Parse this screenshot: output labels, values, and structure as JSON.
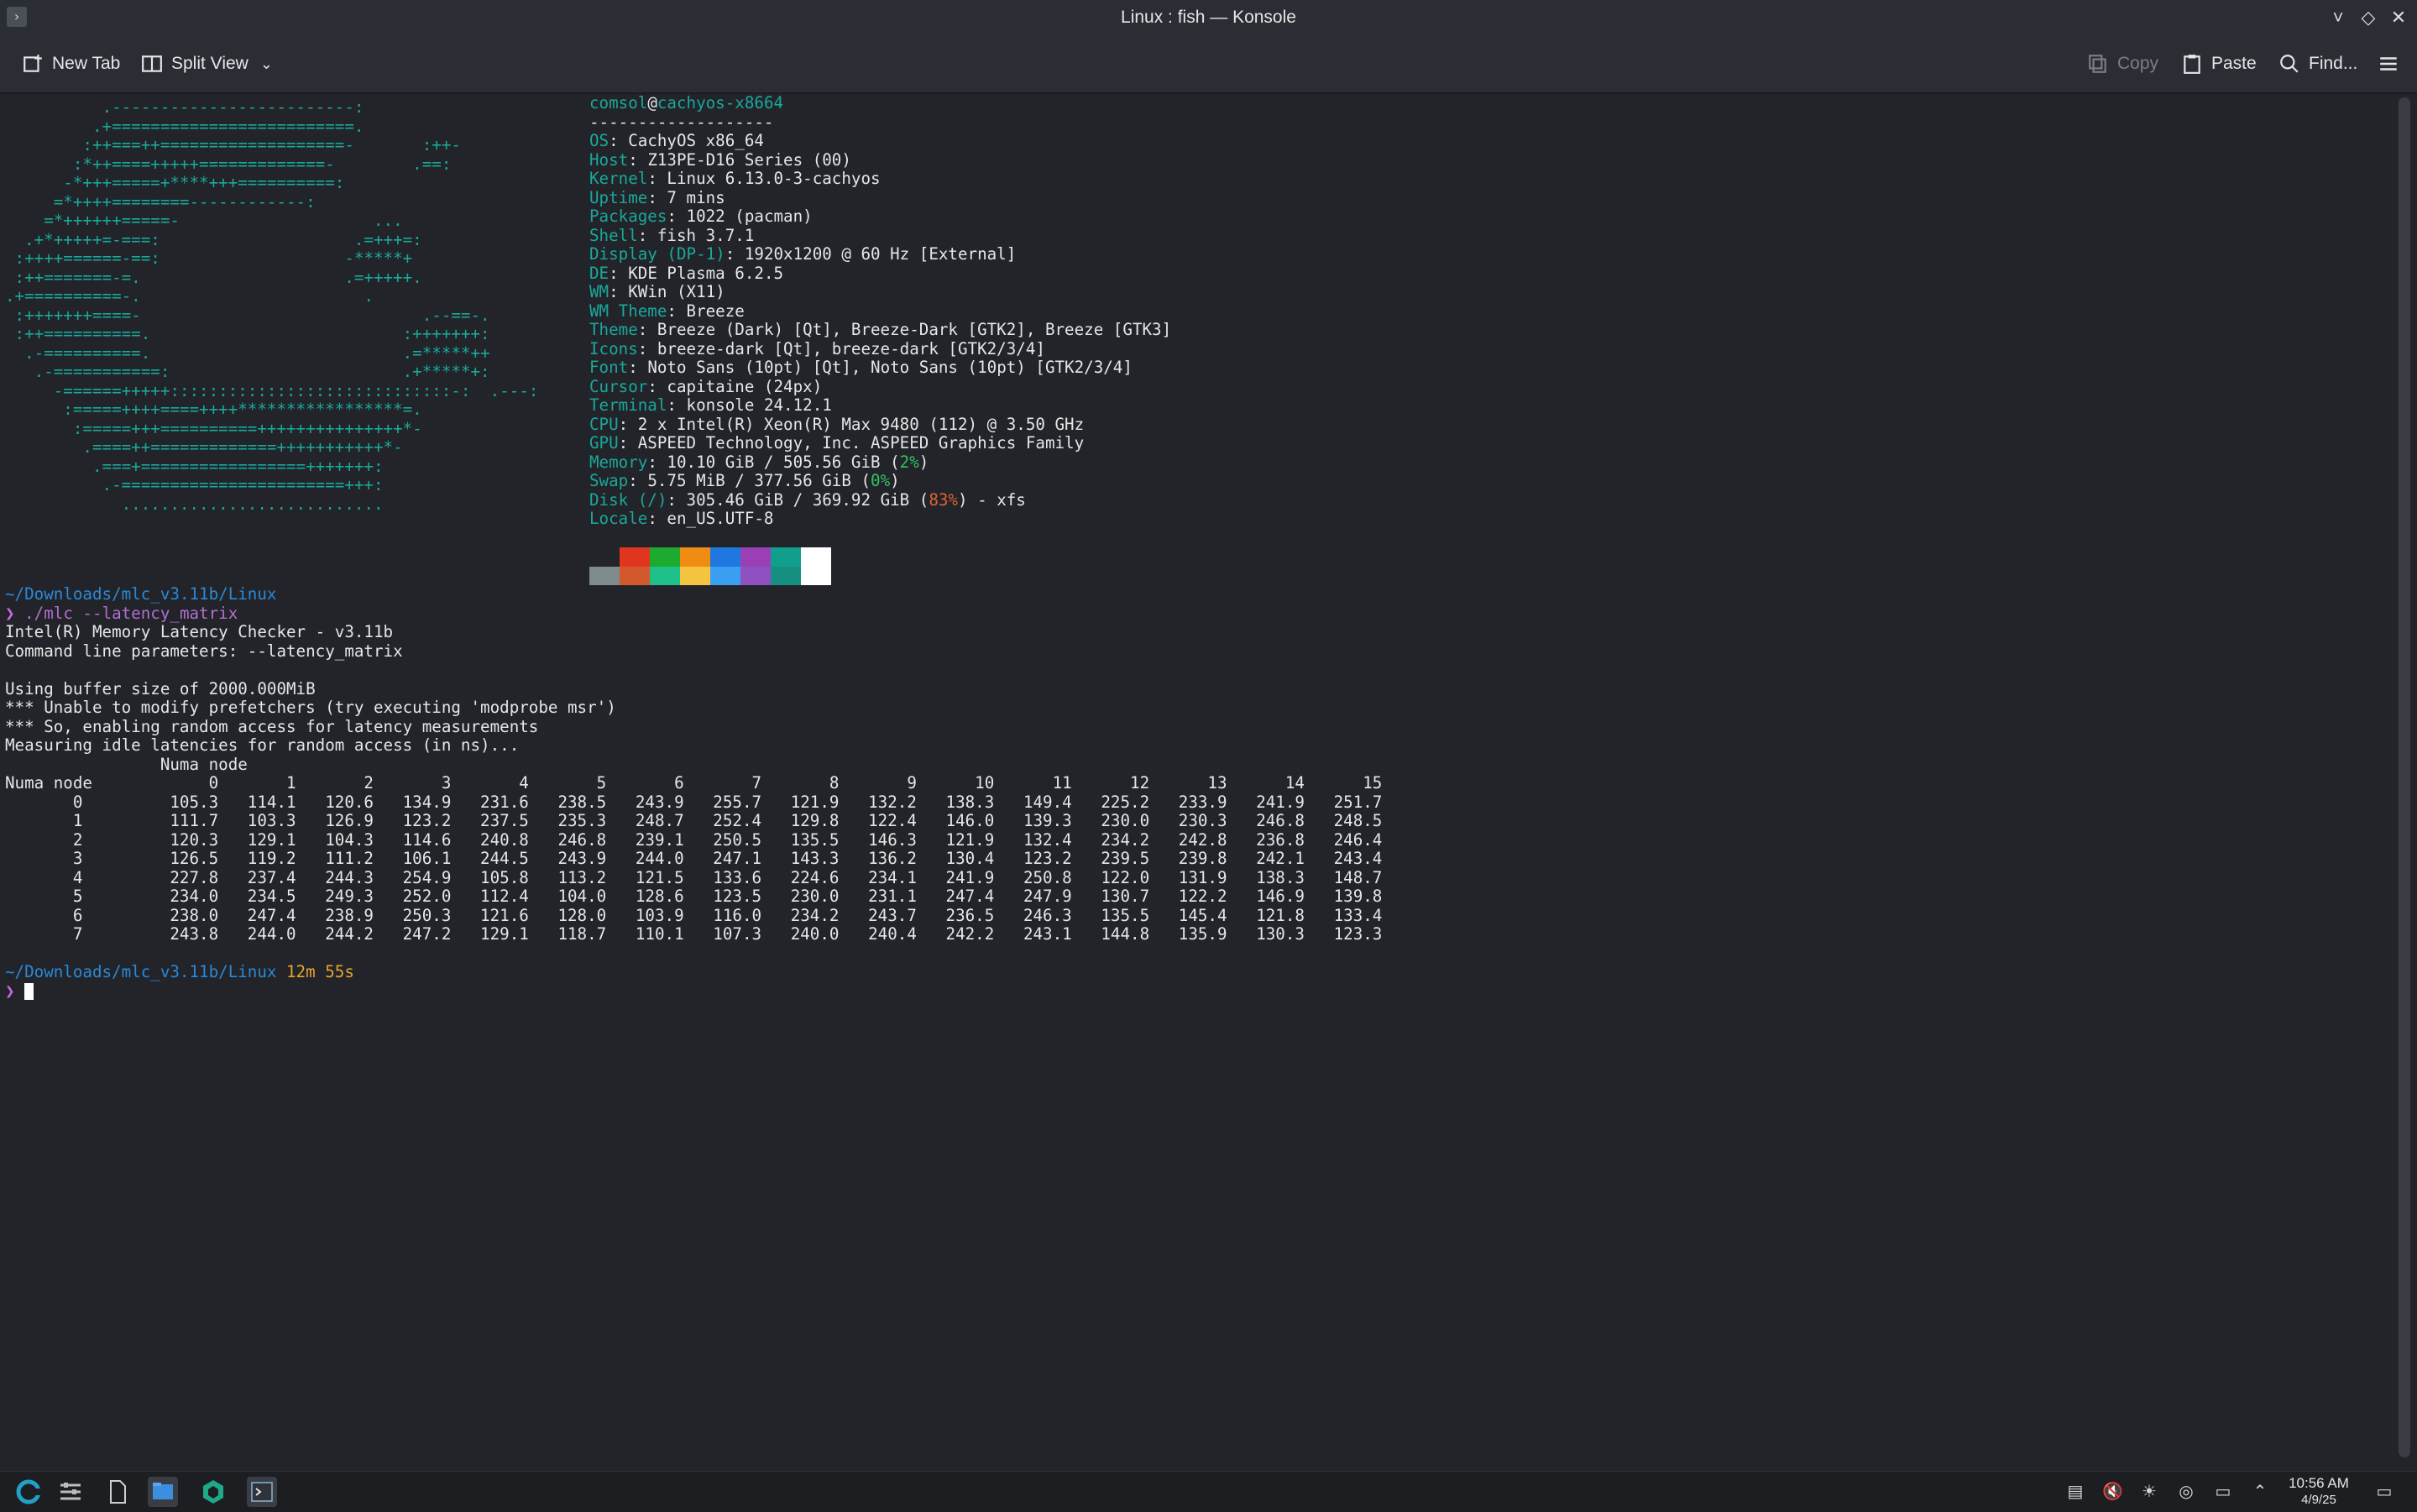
{
  "window": {
    "title": "Linux : fish — Konsole",
    "controls": [
      "˅",
      "◇",
      "✕"
    ]
  },
  "toolbar": {
    "new_tab": "New Tab",
    "split_view": "Split View",
    "copy": "Copy",
    "paste": "Paste",
    "find": "Find..."
  },
  "ascii_art": [
    "          .-------------------------:",
    "         .+=========================.",
    "        :++===++===================-       :++-",
    "       :*++====+++++=============-        .==:",
    "      -*+++=====+****+++==========:",
    "     =*++++========------------:",
    "    =*++++++=====-                    ...",
    "  .+*+++++=-===:                    .=+++=:",
    " :++++======-==:                   -*****+",
    " :++=======-=.                     .=+++++.",
    ".+==========-.                       .",
    " :+++++++====-                             .--==-.",
    " :++==========.                          :+++++++:",
    "  .-==========.                          .=*****++",
    "   .-===========:                        .+*****+:",
    "     -======+++++:::::::::::::::::::::::::::::-:  .---:",
    "      :=====++++====++++*****************=.",
    "       :=====+++==========+++++++++++++++*-",
    "        .====++=============+++++++++++*-",
    "         .===+=================+++++++:",
    "          .-=======================+++:",
    "            ..........................."
  ],
  "sysinfo": {
    "user": "comsol",
    "at": "@",
    "host": "cachyos-x8664",
    "separator": "-------------------",
    "rows": [
      {
        "key": "OS",
        "value": ": CachyOS x86_64"
      },
      {
        "key": "Host",
        "value": ": Z13PE-D16 Series (00)"
      },
      {
        "key": "Kernel",
        "value": ": Linux 6.13.0-3-cachyos"
      },
      {
        "key": "Uptime",
        "value": ": 7 mins"
      },
      {
        "key": "Packages",
        "value": ": 1022 (pacman)"
      },
      {
        "key": "Shell",
        "value": ": fish 3.7.1"
      },
      {
        "key": "Display (DP-1)",
        "value": ": 1920x1200 @ 60 Hz [External]"
      },
      {
        "key": "DE",
        "value": ": KDE Plasma 6.2.5"
      },
      {
        "key": "WM",
        "value": ": KWin (X11)"
      },
      {
        "key": "WM Theme",
        "value": ": Breeze"
      },
      {
        "key": "Theme",
        "value": ": Breeze (Dark) [Qt], Breeze-Dark [GTK2], Breeze [GTK3]"
      },
      {
        "key": "Icons",
        "value": ": breeze-dark [Qt], breeze-dark [GTK2/3/4]"
      },
      {
        "key": "Font",
        "value": ": Noto Sans (10pt) [Qt], Noto Sans (10pt) [GTK2/3/4]"
      },
      {
        "key": "Cursor",
        "value": ": capitaine (24px)"
      },
      {
        "key": "Terminal",
        "value": ": konsole 24.12.1"
      },
      {
        "key": "CPU",
        "value": ": 2 x Intel(R) Xeon(R) Max 9480 (112) @ 3.50 GHz"
      },
      {
        "key": "GPU",
        "value": ": ASPEED Technology, Inc. ASPEED Graphics Family"
      }
    ],
    "memory": {
      "key": "Memory",
      "pre": ": 10.10 GiB / 505.56 GiB (",
      "pct": "2%",
      "post": ")"
    },
    "swap": {
      "key": "Swap",
      "pre": ": 5.75 MiB / 377.56 GiB (",
      "pct": "0%",
      "post": ")"
    },
    "disk": {
      "key": "Disk (/)",
      "pre": ": 305.46 GiB / 369.92 GiB (",
      "pct": "83%",
      "post": ") - xfs"
    },
    "locale": {
      "key": "Locale",
      "value": ": en_US.UTF-8"
    },
    "palette_top": [
      "#222429",
      "#e0351f",
      "#1cab2f",
      "#f08c12",
      "#1f78e0",
      "#9b3fb7",
      "#129e8c",
      "#ffffff"
    ],
    "palette_bottom": [
      "#7f8c8d",
      "#d3582b",
      "#1fbf8a",
      "#f5c542",
      "#3a9ff0",
      "#8e4fc0",
      "#168f80",
      "#ffffff"
    ]
  },
  "session1": {
    "path": "~/Downloads/mlc_v3.11b/Linux",
    "prompt": "❯",
    "command": " ./mlc --latency_matrix",
    "output": [
      "Intel(R) Memory Latency Checker - v3.11b",
      "Command line parameters: --latency_matrix",
      "",
      "Using buffer size of 2000.000MiB",
      "*** Unable to modify prefetchers (try executing 'modprobe msr')",
      "*** So, enabling random access for latency measurements",
      "Measuring idle latencies for random access (in ns)..."
    ]
  },
  "matrix": {
    "header_top": "                Numa node",
    "header_row": "Numa node            0       1       2       3       4       5       6       7       8       9      10      11      12      13      14      15",
    "rows": [
      "       0         105.3   114.1   120.6   134.9   231.6   238.5   243.9   255.7   121.9   132.2   138.3   149.4   225.2   233.9   241.9   251.7",
      "       1         111.7   103.3   126.9   123.2   237.5   235.3   248.7   252.4   129.8   122.4   146.0   139.3   230.0   230.3   246.8   248.5",
      "       2         120.3   129.1   104.3   114.6   240.8   246.8   239.1   250.5   135.5   146.3   121.9   132.4   234.2   242.8   236.8   246.4",
      "       3         126.5   119.2   111.2   106.1   244.5   243.9   244.0   247.1   143.3   136.2   130.4   123.2   239.5   239.8   242.1   243.4",
      "       4         227.8   237.4   244.3   254.9   105.8   113.2   121.5   133.6   224.6   234.1   241.9   250.8   122.0   131.9   138.3   148.7",
      "       5         234.0   234.5   249.3   252.0   112.4   104.0   128.6   123.5   230.0   231.1   247.4   247.9   130.7   122.2   146.9   139.8",
      "       6         238.0   247.4   238.9   250.3   121.6   128.0   103.9   116.0   234.2   243.7   236.5   246.3   135.5   145.4   121.8   133.4",
      "       7         243.8   244.0   244.2   247.2   129.1   118.7   110.1   107.3   240.0   240.4   242.2   243.1   144.8   135.9   130.3   123.3"
    ]
  },
  "session2": {
    "path": "~/Downloads/mlc_v3.11b/Linux",
    "duration": " 12m 55s",
    "prompt": "❯ "
  },
  "taskbar": {
    "clock_time": "10:56 AM",
    "clock_date": "4/9/25"
  }
}
